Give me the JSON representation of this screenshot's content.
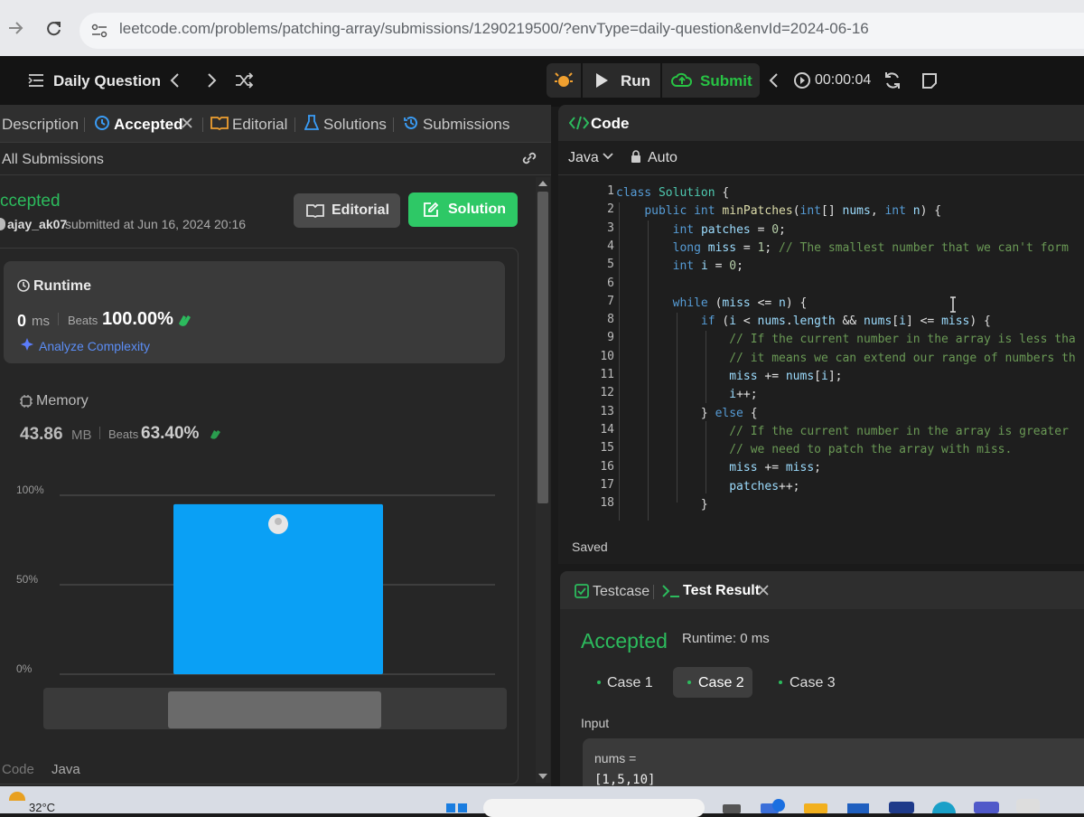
{
  "browser": {
    "url": "leetcode.com/problems/patching-array/submissions/1290219500/?envType=daily-question&envId=2024-06-16"
  },
  "header": {
    "title": "Daily Question",
    "run_label": "Run",
    "submit_label": "Submit",
    "timer": "00:00:04"
  },
  "left_tabs": {
    "description": "Description",
    "accepted": "Accepted",
    "editorial": "Editorial",
    "solutions": "Solutions",
    "submissions": "Submissions"
  },
  "submission": {
    "all_submissions": "All Submissions",
    "status": "ccepted",
    "user": "ajay_ak07",
    "submitted_text": "submitted at Jun 16, 2024 20:16",
    "editorial_button": "Editorial",
    "solution_button": "Solution"
  },
  "runtime": {
    "label": "Runtime",
    "value": "0",
    "unit": "ms",
    "beats_label": "Beats",
    "beats_value": "100.00%",
    "analyze": "Analyze Complexity"
  },
  "memory": {
    "label": "Memory",
    "value": "43.86",
    "unit": "MB",
    "beats_label": "Beats",
    "beats_value": "63.40%"
  },
  "chart_data": {
    "type": "bar",
    "y_ticks": [
      "100%",
      "50%",
      "0%"
    ],
    "ylim": [
      0,
      100
    ],
    "values": [
      95
    ],
    "highlighted_index": 0,
    "bar_color": "#0aa0f5"
  },
  "code_footer": {
    "code_label": "Code",
    "lang": "Java"
  },
  "editor": {
    "title": "Code",
    "language": "Java",
    "mode": "Auto",
    "saved": "Saved",
    "line_numbers": [
      "1",
      "2",
      "3",
      "4",
      "5",
      "6",
      "7",
      "8",
      "9",
      "10",
      "11",
      "12",
      "13",
      "14",
      "15",
      "16",
      "17",
      "18"
    ]
  },
  "result": {
    "testcase_tab": "Testcase",
    "testresult_tab": "Test Result",
    "status": "Accepted",
    "runtime": "Runtime: 0 ms",
    "cases": [
      "Case 1",
      "Case 2",
      "Case 3"
    ],
    "input_label": "Input",
    "var_name": "nums =",
    "var_value": "[1,5,10]"
  },
  "taskbar": {
    "temperature": "32°C"
  },
  "colors": {
    "accent_green": "#2cbb5d",
    "submit_green": "#28c244",
    "solution_button": "#2ec866",
    "bar_blue": "#0aa0f5"
  }
}
